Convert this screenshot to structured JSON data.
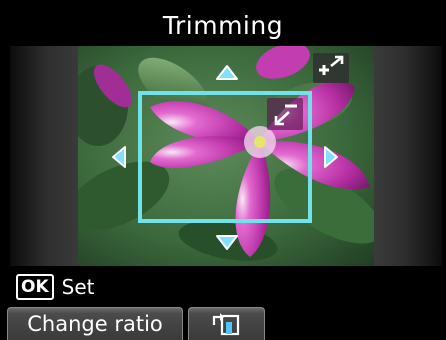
{
  "header": {
    "title": "Trimming"
  },
  "preview": {
    "icons": {
      "zoom_in": "zoom-in-icon",
      "zoom_out": "zoom-out-icon",
      "arrow_up": "arrow-up-icon",
      "arrow_down": "arrow-down-icon",
      "arrow_left": "arrow-left-icon",
      "arrow_right": "arrow-right-icon"
    }
  },
  "footer": {
    "ok_key": "OK",
    "ok_label": "Set",
    "change_ratio_label": "Change ratio",
    "rotate_icon": "rotate-frame-icon"
  },
  "colors": {
    "frame": "#6fe2ea",
    "background": "#000000",
    "button": "#4b4b4b"
  }
}
